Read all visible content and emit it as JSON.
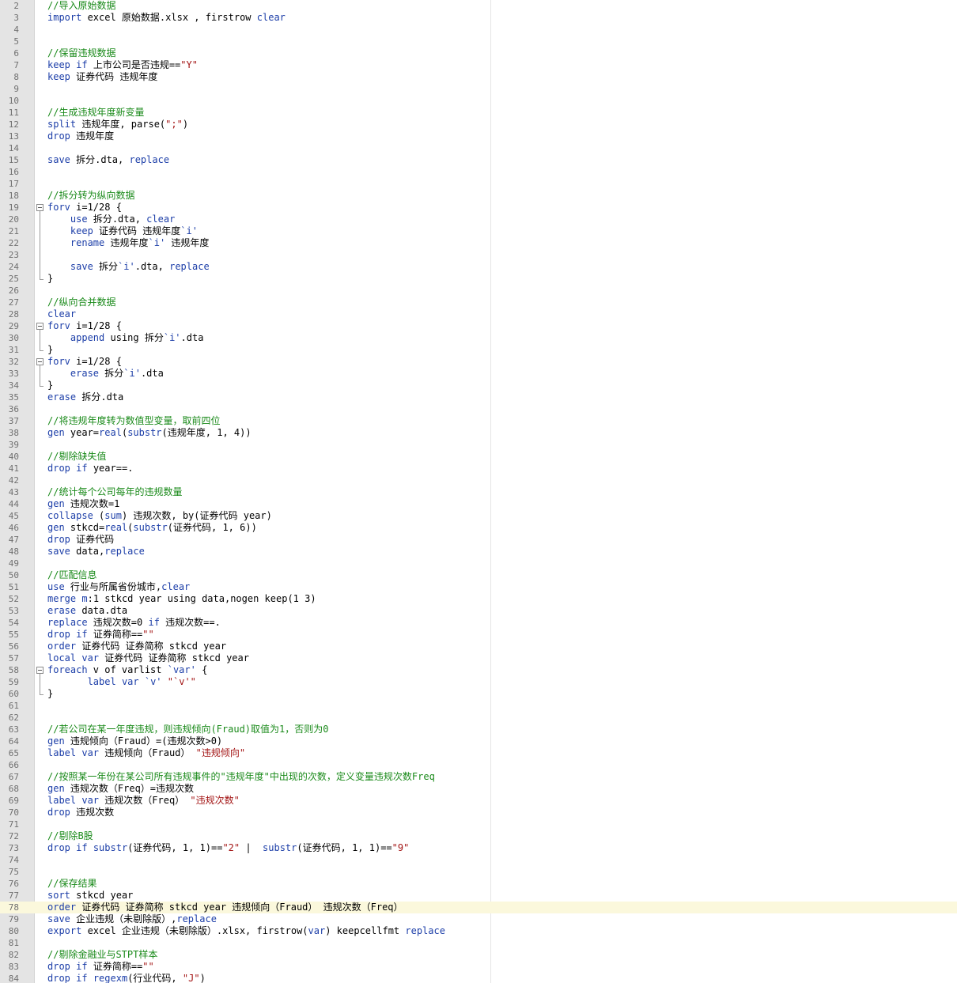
{
  "editor": {
    "colors": {
      "keyword": "#1c3ea8",
      "comment": "#1a8a1a",
      "string": "#a31515",
      "text": "#000000",
      "gutter": "#e4e4e4",
      "current_line": "#fbf8dc"
    },
    "current_line": 78,
    "fold_markers": [
      {
        "start": 19,
        "end": 25
      },
      {
        "start": 29,
        "end": 31
      },
      {
        "start": 32,
        "end": 34
      },
      {
        "start": 58,
        "end": 60
      }
    ],
    "lines": [
      {
        "n": "2",
        "tokens": [
          {
            "t": "c",
            "v": "//导入原始数据"
          }
        ]
      },
      {
        "n": "3",
        "tokens": [
          {
            "t": "k",
            "v": "import"
          },
          {
            "t": "p",
            "v": " excel 原始数据.xlsx , firstrow "
          },
          {
            "t": "k",
            "v": "clear"
          }
        ]
      },
      {
        "n": "4",
        "tokens": []
      },
      {
        "n": "5",
        "tokens": []
      },
      {
        "n": "6",
        "tokens": [
          {
            "t": "c",
            "v": "//保留违规数据"
          }
        ]
      },
      {
        "n": "7",
        "tokens": [
          {
            "t": "k",
            "v": "keep"
          },
          {
            "t": "p",
            "v": " "
          },
          {
            "t": "k",
            "v": "if"
          },
          {
            "t": "p",
            "v": " 上市公司是否违规=="
          },
          {
            "t": "s",
            "v": "\"Y\""
          }
        ]
      },
      {
        "n": "8",
        "tokens": [
          {
            "t": "k",
            "v": "keep"
          },
          {
            "t": "p",
            "v": " 证券代码 违规年度"
          }
        ]
      },
      {
        "n": "9",
        "tokens": []
      },
      {
        "n": "10",
        "tokens": []
      },
      {
        "n": "11",
        "tokens": [
          {
            "t": "c",
            "v": "//生成违规年度新变量"
          }
        ]
      },
      {
        "n": "12",
        "tokens": [
          {
            "t": "k",
            "v": "split"
          },
          {
            "t": "p",
            "v": " 违规年度, parse("
          },
          {
            "t": "s",
            "v": "\";\""
          },
          {
            "t": "p",
            "v": ")"
          }
        ]
      },
      {
        "n": "13",
        "tokens": [
          {
            "t": "k",
            "v": "drop"
          },
          {
            "t": "p",
            "v": " 违规年度"
          }
        ]
      },
      {
        "n": "14",
        "tokens": []
      },
      {
        "n": "15",
        "tokens": [
          {
            "t": "k",
            "v": "save"
          },
          {
            "t": "p",
            "v": " 拆分.dta, "
          },
          {
            "t": "k",
            "v": "replace"
          }
        ]
      },
      {
        "n": "16",
        "tokens": []
      },
      {
        "n": "17",
        "tokens": []
      },
      {
        "n": "18",
        "tokens": [
          {
            "t": "c",
            "v": "//拆分转为纵向数据"
          }
        ]
      },
      {
        "n": "19",
        "tokens": [
          {
            "t": "k",
            "v": "forv"
          },
          {
            "t": "p",
            "v": " i=1/28 {"
          }
        ]
      },
      {
        "n": "20",
        "tokens": [
          {
            "t": "p",
            "v": "    "
          },
          {
            "t": "k",
            "v": "use"
          },
          {
            "t": "p",
            "v": " 拆分.dta, "
          },
          {
            "t": "k",
            "v": "clear"
          }
        ]
      },
      {
        "n": "21",
        "tokens": [
          {
            "t": "p",
            "v": "    "
          },
          {
            "t": "k",
            "v": "keep"
          },
          {
            "t": "p",
            "v": " 证券代码 违规年度"
          },
          {
            "t": "k",
            "v": "`i'"
          }
        ]
      },
      {
        "n": "22",
        "tokens": [
          {
            "t": "p",
            "v": "    "
          },
          {
            "t": "k",
            "v": "rename"
          },
          {
            "t": "p",
            "v": " 违规年度"
          },
          {
            "t": "k",
            "v": "`i'"
          },
          {
            "t": "p",
            "v": " 违规年度"
          }
        ]
      },
      {
        "n": "23",
        "tokens": []
      },
      {
        "n": "24",
        "tokens": [
          {
            "t": "p",
            "v": "    "
          },
          {
            "t": "k",
            "v": "save"
          },
          {
            "t": "p",
            "v": " 拆分"
          },
          {
            "t": "k",
            "v": "`i'"
          },
          {
            "t": "p",
            "v": ".dta, "
          },
          {
            "t": "k",
            "v": "replace"
          }
        ]
      },
      {
        "n": "25",
        "tokens": [
          {
            "t": "p",
            "v": "}"
          }
        ]
      },
      {
        "n": "26",
        "tokens": []
      },
      {
        "n": "27",
        "tokens": [
          {
            "t": "c",
            "v": "//纵向合并数据"
          }
        ]
      },
      {
        "n": "28",
        "tokens": [
          {
            "t": "k",
            "v": "clear"
          }
        ]
      },
      {
        "n": "29",
        "tokens": [
          {
            "t": "k",
            "v": "forv"
          },
          {
            "t": "p",
            "v": " i=1/28 {"
          }
        ]
      },
      {
        "n": "30",
        "tokens": [
          {
            "t": "p",
            "v": "    "
          },
          {
            "t": "k",
            "v": "append"
          },
          {
            "t": "p",
            "v": " using 拆分"
          },
          {
            "t": "k",
            "v": "`i'"
          },
          {
            "t": "p",
            "v": ".dta"
          }
        ]
      },
      {
        "n": "31",
        "tokens": [
          {
            "t": "p",
            "v": "}"
          }
        ]
      },
      {
        "n": "32",
        "tokens": [
          {
            "t": "k",
            "v": "forv"
          },
          {
            "t": "p",
            "v": " i=1/28 {"
          }
        ]
      },
      {
        "n": "33",
        "tokens": [
          {
            "t": "p",
            "v": "    "
          },
          {
            "t": "k",
            "v": "erase"
          },
          {
            "t": "p",
            "v": " 拆分"
          },
          {
            "t": "k",
            "v": "`i'"
          },
          {
            "t": "p",
            "v": ".dta"
          }
        ]
      },
      {
        "n": "34",
        "tokens": [
          {
            "t": "p",
            "v": "}"
          }
        ]
      },
      {
        "n": "35",
        "tokens": [
          {
            "t": "k",
            "v": "erase"
          },
          {
            "t": "p",
            "v": " 拆分.dta"
          }
        ]
      },
      {
        "n": "36",
        "tokens": []
      },
      {
        "n": "37",
        "tokens": [
          {
            "t": "c",
            "v": "//将违规年度转为数值型变量，取前四位"
          }
        ]
      },
      {
        "n": "38",
        "tokens": [
          {
            "t": "k",
            "v": "gen"
          },
          {
            "t": "p",
            "v": " year="
          },
          {
            "t": "k",
            "v": "real"
          },
          {
            "t": "p",
            "v": "("
          },
          {
            "t": "k",
            "v": "substr"
          },
          {
            "t": "p",
            "v": "(违规年度, 1, 4))"
          }
        ]
      },
      {
        "n": "39",
        "tokens": []
      },
      {
        "n": "40",
        "tokens": [
          {
            "t": "c",
            "v": "//剔除缺失值"
          }
        ]
      },
      {
        "n": "41",
        "tokens": [
          {
            "t": "k",
            "v": "drop"
          },
          {
            "t": "p",
            "v": " "
          },
          {
            "t": "k",
            "v": "if"
          },
          {
            "t": "p",
            "v": " year==."
          }
        ]
      },
      {
        "n": "42",
        "tokens": []
      },
      {
        "n": "43",
        "tokens": [
          {
            "t": "c",
            "v": "//统计每个公司每年的违规数量"
          }
        ]
      },
      {
        "n": "44",
        "tokens": [
          {
            "t": "k",
            "v": "gen"
          },
          {
            "t": "p",
            "v": " 违规次数=1"
          }
        ]
      },
      {
        "n": "45",
        "tokens": [
          {
            "t": "k",
            "v": "collapse"
          },
          {
            "t": "p",
            "v": " ("
          },
          {
            "t": "k",
            "v": "sum"
          },
          {
            "t": "p",
            "v": ") 违规次数, by(证券代码 year)"
          }
        ]
      },
      {
        "n": "46",
        "tokens": [
          {
            "t": "k",
            "v": "gen"
          },
          {
            "t": "p",
            "v": " stkcd="
          },
          {
            "t": "k",
            "v": "real"
          },
          {
            "t": "p",
            "v": "("
          },
          {
            "t": "k",
            "v": "substr"
          },
          {
            "t": "p",
            "v": "(证券代码, 1, 6))"
          }
        ]
      },
      {
        "n": "47",
        "tokens": [
          {
            "t": "k",
            "v": "drop"
          },
          {
            "t": "p",
            "v": " 证券代码"
          }
        ]
      },
      {
        "n": "48",
        "tokens": [
          {
            "t": "k",
            "v": "save"
          },
          {
            "t": "p",
            "v": " data,"
          },
          {
            "t": "k",
            "v": "replace"
          }
        ]
      },
      {
        "n": "49",
        "tokens": []
      },
      {
        "n": "50",
        "tokens": [
          {
            "t": "c",
            "v": "//匹配信息"
          }
        ]
      },
      {
        "n": "51",
        "tokens": [
          {
            "t": "k",
            "v": "use"
          },
          {
            "t": "p",
            "v": " 行业与所属省份城市,"
          },
          {
            "t": "k",
            "v": "clear"
          }
        ]
      },
      {
        "n": "52",
        "tokens": [
          {
            "t": "k",
            "v": "merge"
          },
          {
            "t": "p",
            "v": " "
          },
          {
            "t": "k",
            "v": "m"
          },
          {
            "t": "p",
            "v": ":1 stkcd year using data,nogen keep(1 3)"
          }
        ]
      },
      {
        "n": "53",
        "tokens": [
          {
            "t": "k",
            "v": "erase"
          },
          {
            "t": "p",
            "v": " data.dta"
          }
        ]
      },
      {
        "n": "54",
        "tokens": [
          {
            "t": "k",
            "v": "replace"
          },
          {
            "t": "p",
            "v": " 违规次数=0 "
          },
          {
            "t": "k",
            "v": "if"
          },
          {
            "t": "p",
            "v": " 违规次数==."
          }
        ]
      },
      {
        "n": "55",
        "tokens": [
          {
            "t": "k",
            "v": "drop"
          },
          {
            "t": "p",
            "v": " "
          },
          {
            "t": "k",
            "v": "if"
          },
          {
            "t": "p",
            "v": " 证券简称=="
          },
          {
            "t": "s",
            "v": "\"\""
          }
        ]
      },
      {
        "n": "56",
        "tokens": [
          {
            "t": "k",
            "v": "order"
          },
          {
            "t": "p",
            "v": " 证券代码 证券简称 stkcd year"
          }
        ]
      },
      {
        "n": "57",
        "tokens": [
          {
            "t": "k",
            "v": "local"
          },
          {
            "t": "p",
            "v": " "
          },
          {
            "t": "k",
            "v": "var"
          },
          {
            "t": "p",
            "v": " 证券代码 证券简称 stkcd year"
          }
        ]
      },
      {
        "n": "58",
        "tokens": [
          {
            "t": "k",
            "v": "foreach"
          },
          {
            "t": "p",
            "v": " v of varlist "
          },
          {
            "t": "k",
            "v": "`var'"
          },
          {
            "t": "p",
            "v": " {"
          }
        ]
      },
      {
        "n": "59",
        "tokens": [
          {
            "t": "p",
            "v": "       "
          },
          {
            "t": "k",
            "v": "label"
          },
          {
            "t": "p",
            "v": " "
          },
          {
            "t": "k",
            "v": "var"
          },
          {
            "t": "p",
            "v": " "
          },
          {
            "t": "k",
            "v": "`v'"
          },
          {
            "t": "p",
            "v": " "
          },
          {
            "t": "s",
            "v": "\"`v'\""
          }
        ]
      },
      {
        "n": "60",
        "tokens": [
          {
            "t": "p",
            "v": "}"
          }
        ]
      },
      {
        "n": "61",
        "tokens": []
      },
      {
        "n": "62",
        "tokens": []
      },
      {
        "n": "63",
        "tokens": [
          {
            "t": "c",
            "v": "//若公司在某一年度违规，则违规倾向(Fraud)取值为1，否则为0"
          }
        ]
      },
      {
        "n": "64",
        "tokens": [
          {
            "t": "k",
            "v": "gen"
          },
          {
            "t": "p",
            "v": " 违规倾向（Fraud）=(违规次数>0)"
          }
        ]
      },
      {
        "n": "65",
        "tokens": [
          {
            "t": "k",
            "v": "label"
          },
          {
            "t": "p",
            "v": " "
          },
          {
            "t": "k",
            "v": "var"
          },
          {
            "t": "p",
            "v": " 违规倾向（Fraud） "
          },
          {
            "t": "s",
            "v": "\"违规倾向\""
          }
        ]
      },
      {
        "n": "66",
        "tokens": []
      },
      {
        "n": "67",
        "tokens": [
          {
            "t": "c",
            "v": "//按照某一年份在某公司所有违规事件的\"违规年度\"中出现的次数，定义变量违规次数Freq"
          }
        ]
      },
      {
        "n": "68",
        "tokens": [
          {
            "t": "k",
            "v": "gen"
          },
          {
            "t": "p",
            "v": " 违规次数（Freq）=违规次数"
          }
        ]
      },
      {
        "n": "69",
        "tokens": [
          {
            "t": "k",
            "v": "label"
          },
          {
            "t": "p",
            "v": " "
          },
          {
            "t": "k",
            "v": "var"
          },
          {
            "t": "p",
            "v": " 违规次数（Freq） "
          },
          {
            "t": "s",
            "v": "\"违规次数\""
          }
        ]
      },
      {
        "n": "70",
        "tokens": [
          {
            "t": "k",
            "v": "drop"
          },
          {
            "t": "p",
            "v": " 违规次数"
          }
        ]
      },
      {
        "n": "71",
        "tokens": []
      },
      {
        "n": "72",
        "tokens": [
          {
            "t": "c",
            "v": "//剔除B股"
          }
        ]
      },
      {
        "n": "73",
        "tokens": [
          {
            "t": "k",
            "v": "drop"
          },
          {
            "t": "p",
            "v": " "
          },
          {
            "t": "k",
            "v": "if"
          },
          {
            "t": "p",
            "v": " "
          },
          {
            "t": "k",
            "v": "substr"
          },
          {
            "t": "p",
            "v": "(证券代码, 1, 1)=="
          },
          {
            "t": "s",
            "v": "\"2\""
          },
          {
            "t": "p",
            "v": " |  "
          },
          {
            "t": "k",
            "v": "substr"
          },
          {
            "t": "p",
            "v": "(证券代码, 1, 1)=="
          },
          {
            "t": "s",
            "v": "\"9\""
          }
        ]
      },
      {
        "n": "74",
        "tokens": []
      },
      {
        "n": "75",
        "tokens": []
      },
      {
        "n": "76",
        "tokens": [
          {
            "t": "c",
            "v": "//保存结果"
          }
        ]
      },
      {
        "n": "77",
        "tokens": [
          {
            "t": "k",
            "v": "sort"
          },
          {
            "t": "p",
            "v": " stkcd year"
          }
        ]
      },
      {
        "n": "78",
        "tokens": [
          {
            "t": "k",
            "v": "order"
          },
          {
            "t": "p",
            "v": " 证券代码 证券简称 stkcd year 违规倾向（Fraud） 违规次数（Freq）"
          }
        ]
      },
      {
        "n": "79",
        "tokens": [
          {
            "t": "k",
            "v": "save"
          },
          {
            "t": "p",
            "v": " 企业违规（未剔除版）,"
          },
          {
            "t": "k",
            "v": "replace"
          }
        ]
      },
      {
        "n": "80",
        "tokens": [
          {
            "t": "k",
            "v": "export"
          },
          {
            "t": "p",
            "v": " excel 企业违规（未剔除版）.xlsx, firstrow("
          },
          {
            "t": "k",
            "v": "var"
          },
          {
            "t": "p",
            "v": ") keepcellfmt "
          },
          {
            "t": "k",
            "v": "replace"
          }
        ]
      },
      {
        "n": "81",
        "tokens": []
      },
      {
        "n": "82",
        "tokens": [
          {
            "t": "c",
            "v": "//剔除金融业与STPT样本"
          }
        ]
      },
      {
        "n": "83",
        "tokens": [
          {
            "t": "k",
            "v": "drop"
          },
          {
            "t": "p",
            "v": " "
          },
          {
            "t": "k",
            "v": "if"
          },
          {
            "t": "p",
            "v": " 证券简称=="
          },
          {
            "t": "s",
            "v": "\"\""
          }
        ]
      },
      {
        "n": "84",
        "tokens": [
          {
            "t": "k",
            "v": "drop"
          },
          {
            "t": "p",
            "v": " "
          },
          {
            "t": "k",
            "v": "if"
          },
          {
            "t": "p",
            "v": " "
          },
          {
            "t": "k",
            "v": "regexm"
          },
          {
            "t": "p",
            "v": "(行业代码, "
          },
          {
            "t": "s",
            "v": "\"J\""
          },
          {
            "t": "p",
            "v": ")"
          }
        ]
      }
    ]
  }
}
